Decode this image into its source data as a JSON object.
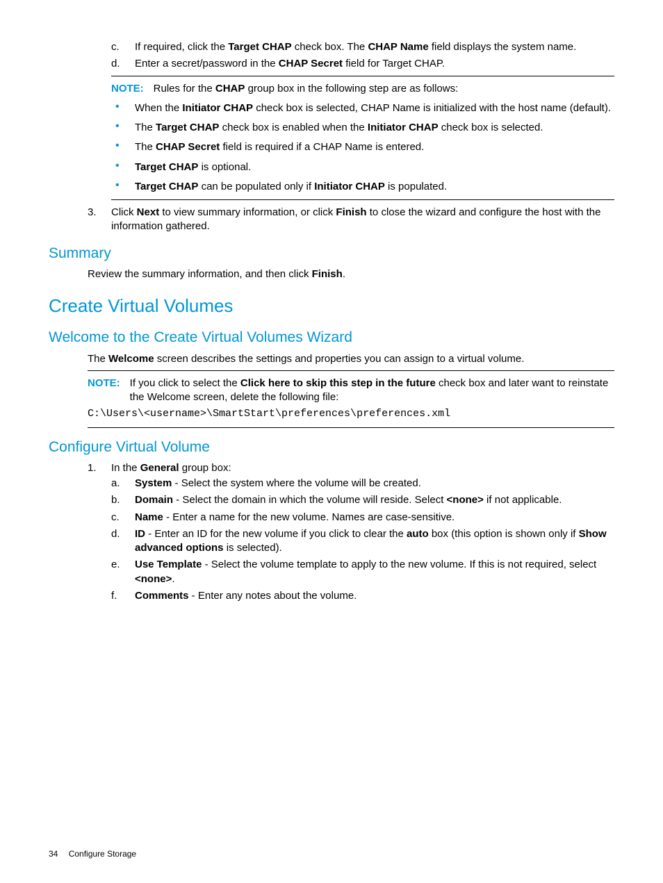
{
  "list_c_letter": "c.",
  "list_c_p1": "If required, click the ",
  "list_c_b1": "Target CHAP",
  "list_c_p2": " check box. The ",
  "list_c_b2": "CHAP Name",
  "list_c_p3": " field displays the system name.",
  "list_d_letter": "d.",
  "list_d_p1": "Enter a secret/password in the ",
  "list_d_b1": "CHAP Secret",
  "list_d_p2": " field for Target CHAP.",
  "note1_label": "NOTE:",
  "note1_p1": "Rules for the ",
  "note1_b1": "CHAP",
  "note1_p2": " group box in the following step are as follows:",
  "b1_p1": "When the ",
  "b1_b1": "Initiator CHAP",
  "b1_p2": " check box is selected, CHAP Name is initialized with the host name (default).",
  "b2_p1": "The ",
  "b2_b1": "Target CHAP",
  "b2_p2": " check box is enabled when the ",
  "b2_b2": "Initiator CHAP",
  "b2_p3": " check box is selected.",
  "b3_p1": "The ",
  "b3_b1": "CHAP Secret",
  "b3_p2": " field is required if a CHAP Name is entered.",
  "b4_b1": "Target CHAP",
  "b4_p1": " is optional.",
  "b5_b1": "Target CHAP",
  "b5_p1": " can be populated only if ",
  "b5_b2": "Initiator CHAP",
  "b5_p2": " is populated.",
  "step3_num": "3.",
  "step3_p1": "Click ",
  "step3_b1": "Next",
  "step3_p2": " to view summary information, or click ",
  "step3_b2": "Finish",
  "step3_p3": " to close the wizard and configure the host with the information gathered.",
  "h_summary": "Summary",
  "summary_p1": "Review the summary information, and then click ",
  "summary_b1": "Finish",
  "summary_p2": ".",
  "h_cvv": "Create Virtual Volumes",
  "h_welcome": "Welcome to the Create Virtual Volumes Wizard",
  "welcome_p1": "The ",
  "welcome_b1": "Welcome",
  "welcome_p2": " screen describes the settings and properties you can assign to a virtual volume.",
  "note2_label": "NOTE:",
  "note2_p1": "If you click to select the ",
  "note2_b1": "Click here to skip this step in the future",
  "note2_p2": " check box and later want to reinstate the Welcome screen, delete the following file:",
  "note2_path": "C:\\Users\\<username>\\SmartStart\\preferences\\preferences.xml",
  "h_config": "Configure Virtual Volume",
  "cv_step1_num": "1.",
  "cv_step1_p1": "In the ",
  "cv_step1_b1": "General",
  "cv_step1_p2": " group box:",
  "cv_a_letter": "a.",
  "cv_a_b1": "System",
  "cv_a_p1": " - Select the system where the volume will be created.",
  "cv_b_letter": "b.",
  "cv_b_b1": "Domain",
  "cv_b_p1": " - Select the domain in which the volume will reside. Select ",
  "cv_b_b2": "<none>",
  "cv_b_p2": " if not applicable.",
  "cv_c_letter": "c.",
  "cv_c_b1": "Name",
  "cv_c_p1": " - Enter a name for the new volume. Names are case-sensitive.",
  "cv_d_letter": "d.",
  "cv_d_b1": "ID",
  "cv_d_p1": " - Enter an ID for the new volume if you click to clear the ",
  "cv_d_b2": "auto",
  "cv_d_p2": " box (this option is shown only if ",
  "cv_d_b3": "Show advanced options",
  "cv_d_p3": " is selected).",
  "cv_e_letter": "e.",
  "cv_e_b1": "Use Template",
  "cv_e_p1": " - Select the volume template to apply to the new volume. If this is not required, select ",
  "cv_e_b2": "<none>",
  "cv_e_p2": ".",
  "cv_f_letter": "f.",
  "cv_f_b1": "Comments",
  "cv_f_p1": " - Enter any notes about the volume.",
  "footer_page": "34",
  "footer_title": "Configure Storage"
}
